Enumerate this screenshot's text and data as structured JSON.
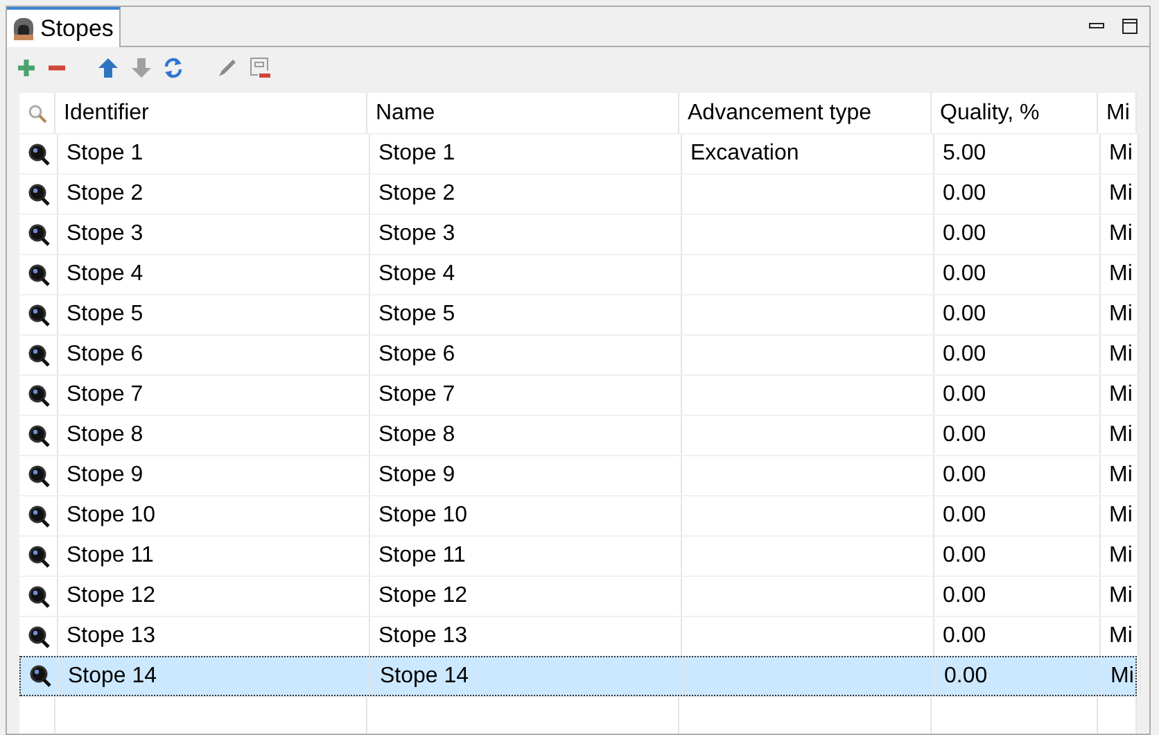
{
  "tab": {
    "title": "Stopes"
  },
  "table": {
    "columns": [
      "Identifier",
      "Name",
      "Advancement type",
      "Quality, %",
      "Mi"
    ],
    "rows": [
      {
        "cells": [
          "Stope 1",
          "Stope 1",
          "Excavation",
          "5.00",
          "Mi"
        ],
        "selected": false
      },
      {
        "cells": [
          "Stope 2",
          "Stope 2",
          "",
          "0.00",
          "Mi"
        ],
        "selected": false
      },
      {
        "cells": [
          "Stope 3",
          "Stope 3",
          "",
          "0.00",
          "Mi"
        ],
        "selected": false
      },
      {
        "cells": [
          "Stope 4",
          "Stope 4",
          "",
          "0.00",
          "Mi"
        ],
        "selected": false
      },
      {
        "cells": [
          "Stope 5",
          "Stope 5",
          "",
          "0.00",
          "Mi"
        ],
        "selected": false
      },
      {
        "cells": [
          "Stope 6",
          "Stope 6",
          "",
          "0.00",
          "Mi"
        ],
        "selected": false
      },
      {
        "cells": [
          "Stope 7",
          "Stope 7",
          "",
          "0.00",
          "Mi"
        ],
        "selected": false
      },
      {
        "cells": [
          "Stope 8",
          "Stope 8",
          "",
          "0.00",
          "Mi"
        ],
        "selected": false
      },
      {
        "cells": [
          "Stope 9",
          "Stope 9",
          "",
          "0.00",
          "Mi"
        ],
        "selected": false
      },
      {
        "cells": [
          "Stope 10",
          "Stope 10",
          "",
          "0.00",
          "Mi"
        ],
        "selected": false
      },
      {
        "cells": [
          "Stope 11",
          "Stope 11",
          "",
          "0.00",
          "Mi"
        ],
        "selected": false
      },
      {
        "cells": [
          "Stope 12",
          "Stope 12",
          "",
          "0.00",
          "Mi"
        ],
        "selected": false
      },
      {
        "cells": [
          "Stope 13",
          "Stope 13",
          "",
          "0.00",
          "Mi"
        ],
        "selected": false
      },
      {
        "cells": [
          "Stope 14",
          "Stope 14",
          "",
          "0.00",
          "Mi"
        ],
        "selected": true
      }
    ]
  }
}
